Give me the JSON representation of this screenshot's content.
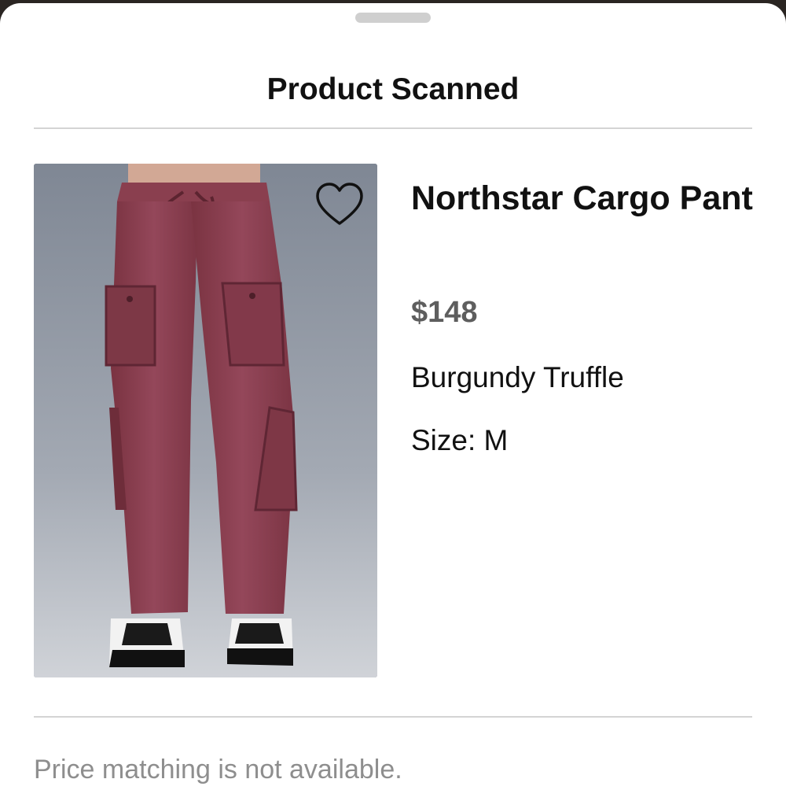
{
  "sheet": {
    "title": "Product Scanned"
  },
  "product": {
    "name": "Northstar Cargo Pant",
    "price": "$148",
    "color_name": "Burgundy Truffle",
    "size_label": "Size:",
    "size_value": "M",
    "image": "burgundy cargo pants with white sneakers"
  },
  "icons": {
    "favorite": "heart-outline-icon"
  },
  "footer": {
    "note": "Price matching is not available."
  },
  "colors": {
    "product_color": "#8b3d4b",
    "price_text": "#5e5e5e",
    "note_text": "#8e8e8e"
  }
}
